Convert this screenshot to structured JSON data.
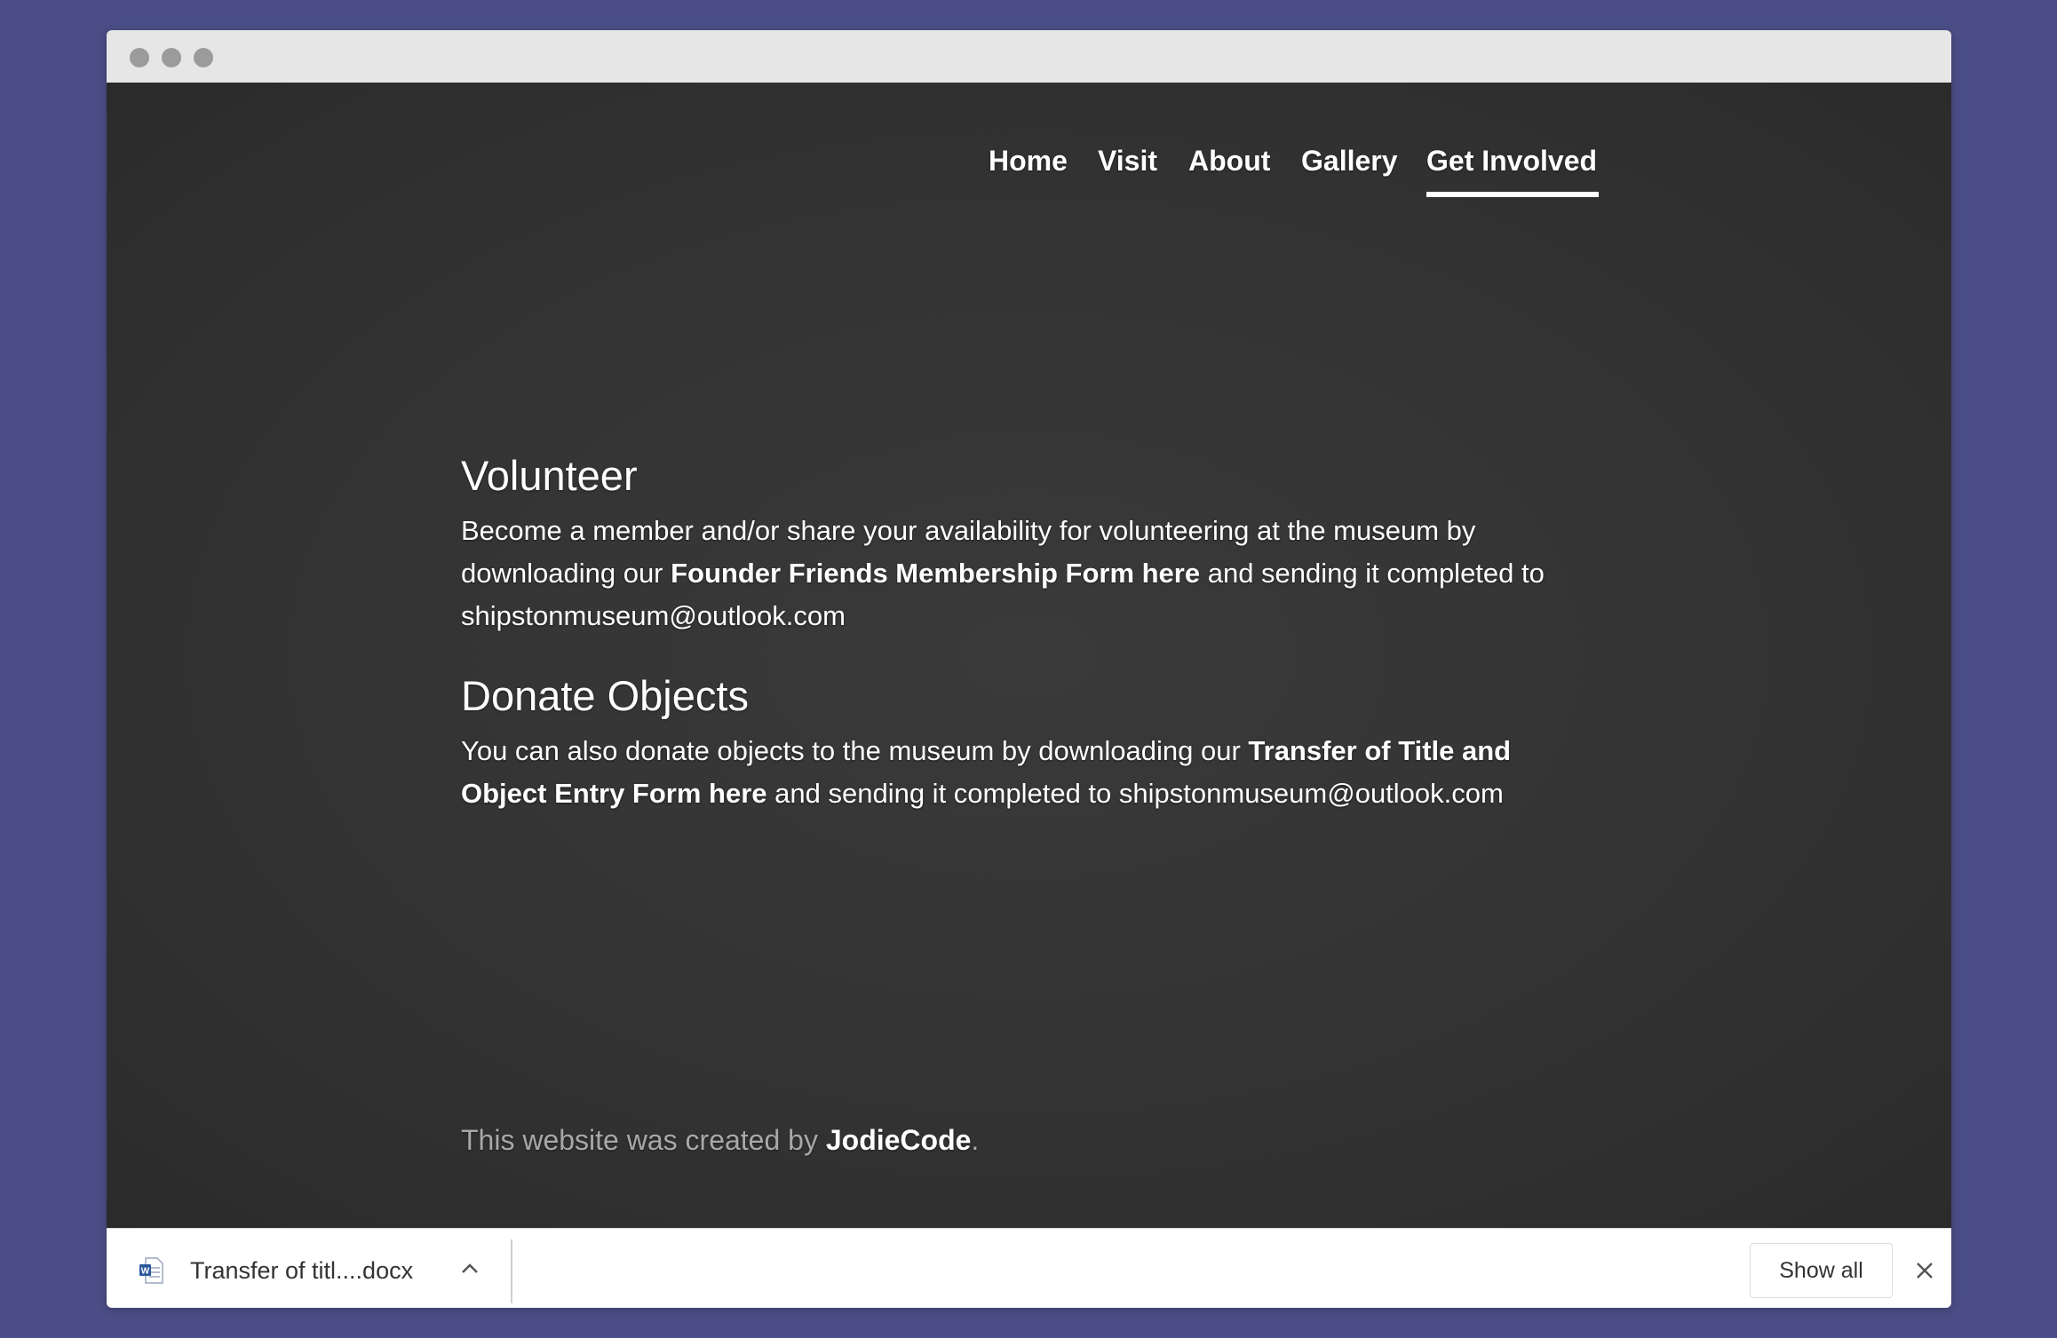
{
  "nav": {
    "items": [
      {
        "label": "Home"
      },
      {
        "label": "Visit"
      },
      {
        "label": "About"
      },
      {
        "label": "Gallery"
      },
      {
        "label": "Get Involved",
        "active": true
      }
    ]
  },
  "volunteer": {
    "heading": "Volunteer",
    "text_before": "Become a member and/or share your availability for volunteering at the museum by downloading our ",
    "link": "Founder Friends Membership Form here",
    "text_after": " and sending it completed to shipstonmuseum@outlook.com"
  },
  "donate": {
    "heading": "Donate Objects",
    "text_before": "You can also donate objects to the museum by downloading our ",
    "link": "Transfer of Title and Object Entry Form here",
    "text_after": " and sending it completed to shipstonmuseum@outlook.com"
  },
  "footer": {
    "text": "This website was created by ",
    "link": "JodieCode",
    "suffix": "."
  },
  "download_bar": {
    "file_name": "Transfer of titl....docx",
    "file_icon": "word-document-icon",
    "show_all_label": "Show all"
  },
  "colors": {
    "page_background": "#4b4e86",
    "site_background": "#333333",
    "text": "#ffffff",
    "footer_text": "#a8a8a8"
  }
}
